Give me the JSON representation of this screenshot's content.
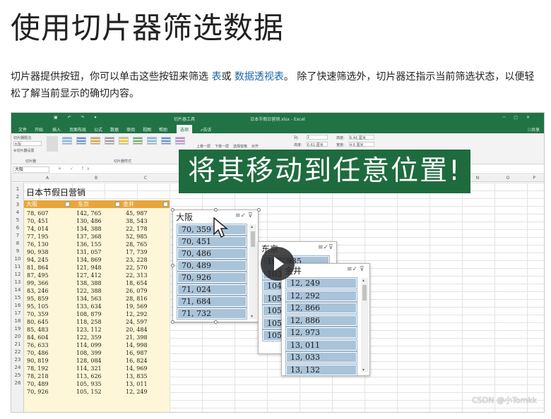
{
  "article": {
    "title": "使用切片器筛选数据",
    "intro_part1": "切片器提供按钮，你可以单击这些按钮来筛选 ",
    "intro_link1": "表",
    "intro_part2": "或 ",
    "intro_link2": "数据透视表",
    "intro_part3": "。 除了快速筛选外，切片器还指示当前筛选状态，以便轻松了解当前显示的确切内容。"
  },
  "excel": {
    "window_title": "日本节假日营销.xlsx - Excel",
    "contextual_tab": "切片器工具",
    "tabs": [
      "文件",
      "开始",
      "插入",
      "页面布局",
      "公式",
      "数据",
      "审阅",
      "视图",
      "帮助",
      "选项",
      "告诉"
    ],
    "active_tab": "选项",
    "share_label": "共享",
    "ribbon": {
      "slicer_caption_label": "切片器题注:",
      "slicer_caption_value": "大阪",
      "slicer_settings": "切片器设置",
      "group_slicer": "切片器",
      "group_styles": "切片器样式",
      "bring_forward": "上移一层",
      "send_backward": "下移一层",
      "selection_pane": "选择窗格",
      "align": "对齐",
      "columns_label": "列:",
      "columns_value": "1",
      "height_label": "高度:",
      "height_value": "0.61 厘米",
      "slicer_height_label": "高度:",
      "slicer_height_value": "6.46 厘米",
      "slicer_width_label": "宽度:",
      "slicer_width_value": "4.6 厘米"
    },
    "name_box": "大阪",
    "fx": "fx",
    "columns": [
      "A",
      "B",
      "C",
      "N",
      "O",
      "P"
    ],
    "sheet_title": "日本节假日营销",
    "headers": [
      "大阪",
      "东京",
      "金井"
    ],
    "rows": [
      [
        "78, 607",
        "142, 765",
        "45, 987"
      ],
      [
        "70, 451",
        "130, 486",
        "38, 543"
      ],
      [
        "74, 014",
        "134, 388",
        "22, 178"
      ],
      [
        "77, 195",
        "137, 368",
        "52, 985"
      ],
      [
        "76, 130",
        "136, 155",
        "28, 765"
      ],
      [
        "90, 938",
        "131, 057",
        "17, 739"
      ],
      [
        "94, 245",
        "134, 869",
        "23, 228"
      ],
      [
        "81, 864",
        "121, 948",
        "22, 570"
      ],
      [
        "87, 495",
        "127, 412",
        "22, 313"
      ],
      [
        "99, 366",
        "138, 388",
        "18, 654"
      ],
      [
        "83, 246",
        "122, 388",
        "26, 079"
      ],
      [
        "95, 859",
        "134, 563",
        "28, 816"
      ],
      [
        "95, 105",
        "133, 634",
        "19, 569"
      ],
      [
        "70, 359",
        "108, 879",
        "12, 292"
      ],
      [
        "80, 645",
        "118, 258",
        "24, 597"
      ],
      [
        "85, 483",
        "123, 112",
        "20, 484"
      ],
      [
        "84, 604",
        "122, 359",
        "21, 398"
      ],
      [
        "76, 633",
        "114, 099",
        "14, 998"
      ],
      [
        "70, 486",
        "108, 399",
        "16, 987"
      ],
      [
        "90, 819",
        "128, 084",
        "16, 824"
      ],
      [
        "78, 192",
        "114, 321",
        "14, 969"
      ],
      [
        "78, 218",
        "113, 626",
        "13, 835"
      ],
      [
        "70, 489",
        "105, 935",
        "13, 011"
      ],
      [
        "70, 926",
        "105, 152",
        "12, 249"
      ]
    ]
  },
  "banner": "将其移动到任意位置!",
  "slicers": {
    "osaka": {
      "title": "大阪",
      "items": [
        "70, 359",
        "70, 451",
        "70, 486",
        "70, 489",
        "70, 926",
        "71, 024",
        "71, 684",
        "71, 732"
      ]
    },
    "tokyo": {
      "title": "东京",
      "items": [
        "105, 935",
        "103",
        "104",
        "105",
        "105",
        "105",
        "105"
      ]
    },
    "kanai": {
      "title": "金井",
      "items": [
        "12, 249",
        "12, 292",
        "12, 866",
        "12, 886",
        "12, 973",
        "13, 011",
        "13, 033",
        "13, 132"
      ]
    }
  },
  "watermark": "CSDN @小Tomkk"
}
